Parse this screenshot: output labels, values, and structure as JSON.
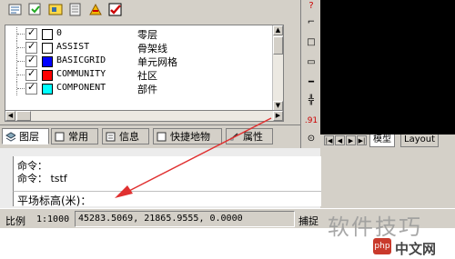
{
  "toolbar": {
    "icons": [
      "layer-tools-icon",
      "layer-state-icon",
      "layer-props-icon",
      "layer-previous-icon",
      "layer-isolate-icon",
      "layer-check-icon"
    ]
  },
  "layers": {
    "rows": [
      {
        "name": "0",
        "desc": "零层",
        "color": "#ffffff"
      },
      {
        "name": "ASSIST",
        "desc": "骨架线",
        "color": "#ffffff"
      },
      {
        "name": "BASICGRID",
        "desc": "单元网格",
        "color": "#0000ff"
      },
      {
        "name": "COMMUNITY",
        "desc": "社区",
        "color": "#ff0000"
      },
      {
        "name": "COMPONENT",
        "desc": "部件",
        "color": "#00ffff"
      }
    ]
  },
  "palette_tabs": [
    {
      "label": "图层",
      "icon": "layers-icon"
    },
    {
      "label": "常用",
      "icon": "common-icon"
    },
    {
      "label": "信息",
      "icon": "info-icon"
    },
    {
      "label": "快捷地物",
      "icon": "shortcut-icon"
    },
    {
      "label": "属性",
      "icon": "property-icon"
    }
  ],
  "right_tools": [
    "?",
    "⌐",
    "□",
    "▭",
    "━",
    "╬",
    ".91",
    "⊙"
  ],
  "layout_tabs": {
    "model": "模型",
    "layout": "Layout"
  },
  "command": {
    "line1": "命令：",
    "line2": "命令： tstf",
    "prompt": "平场标高(米)："
  },
  "status": {
    "scale_label": "比例",
    "scale_value": "1:1000",
    "coords": "45283.5069, 21865.9555, 0.0000",
    "snap": "捕捉"
  },
  "watermark": {
    "text": "软件技巧",
    "badge": "php",
    "site": "中文网"
  },
  "colors": {
    "arrow": "#e03030",
    "canvas": "#000000"
  }
}
